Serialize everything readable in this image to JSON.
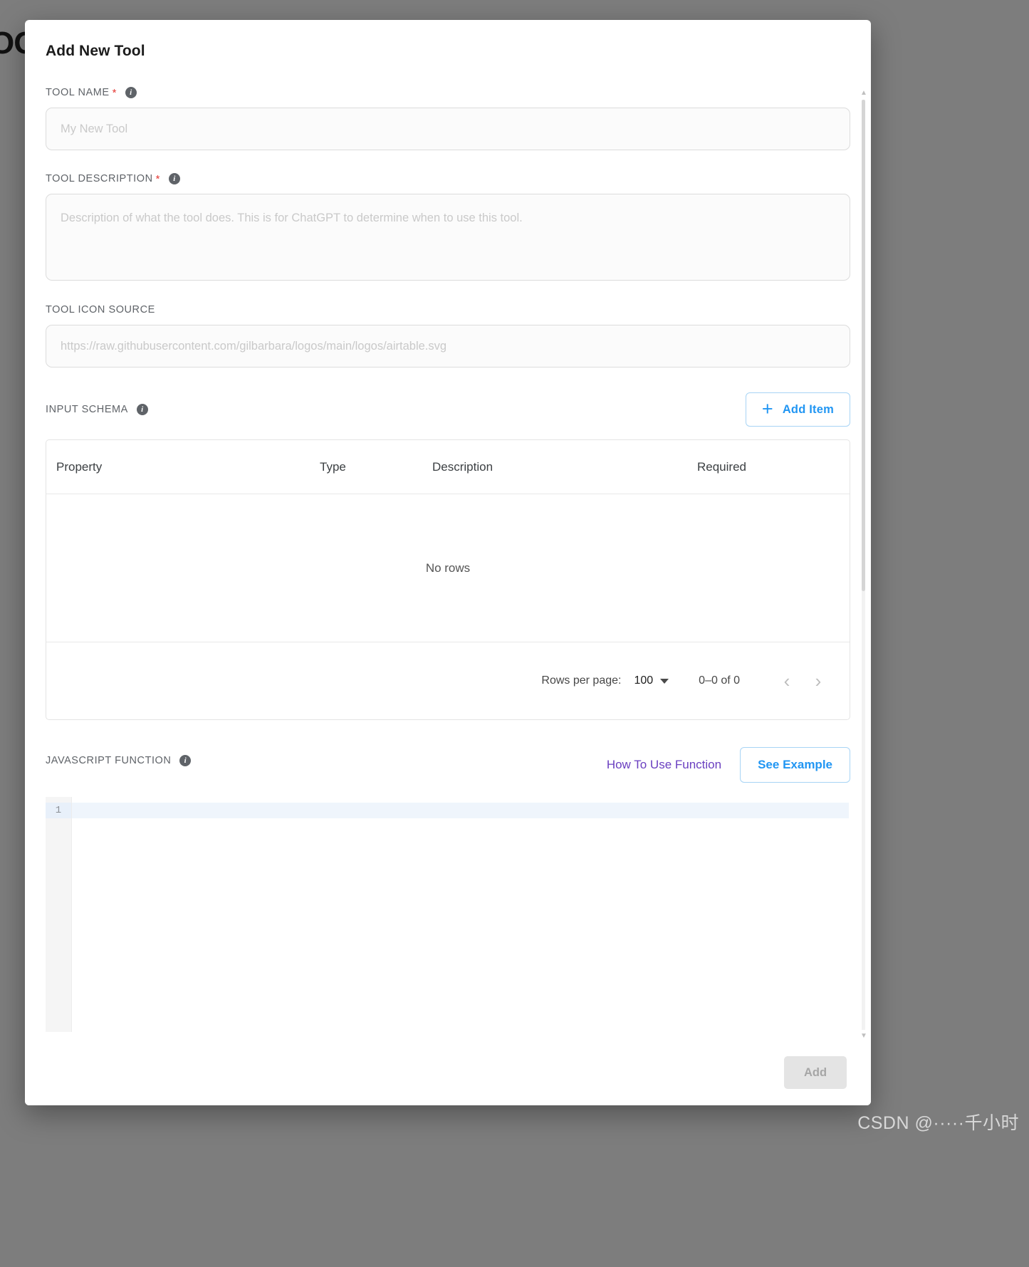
{
  "background": {
    "behind_text": "OO",
    "overlay_color": "#7d7d7d"
  },
  "modal": {
    "title": "Add New Tool",
    "fields": {
      "tool_name": {
        "label": "TOOL NAME",
        "required_marker": "*",
        "info_glyph": "i",
        "value": "",
        "placeholder": "My New Tool"
      },
      "tool_description": {
        "label": "TOOL DESCRIPTION",
        "required_marker": "*",
        "info_glyph": "i",
        "value": "",
        "placeholder": "Description of what the tool does. This is for ChatGPT to determine when to use this tool."
      },
      "tool_icon_source": {
        "label": "TOOL ICON SOURCE",
        "value": "",
        "placeholder": "https://raw.githubusercontent.com/gilbarbara/logos/main/logos/airtable.svg"
      }
    },
    "input_schema": {
      "label": "INPUT SCHEMA",
      "info_glyph": "i",
      "add_item_label": "Add Item",
      "plus_glyph": "+",
      "columns": [
        "Property",
        "Type",
        "Description",
        "Required"
      ],
      "rows": [],
      "empty_text": "No rows",
      "pagination": {
        "rows_per_page_label": "Rows per page:",
        "rows_per_page_value": "100",
        "range_text": "0–0 of 0",
        "prev_glyph": "‹",
        "next_glyph": "›"
      }
    },
    "javascript_function": {
      "label": "JAVASCRIPT FUNCTION",
      "info_glyph": "i",
      "how_to_use_label": "How To Use Function",
      "see_example_label": "See Example",
      "editor": {
        "line_numbers": [
          "1"
        ],
        "code": ""
      }
    },
    "footer": {
      "add_label": "Add",
      "add_enabled": false
    },
    "scrollbar": {
      "up_glyph": "▲",
      "down_glyph": "▼"
    }
  },
  "watermark": "CSDN @·····千小时",
  "colors": {
    "accent_blue": "#2196f3",
    "link_purple": "#6a3fc0",
    "required_red": "#e53935",
    "disabled_grey": "#e4e4e4"
  }
}
